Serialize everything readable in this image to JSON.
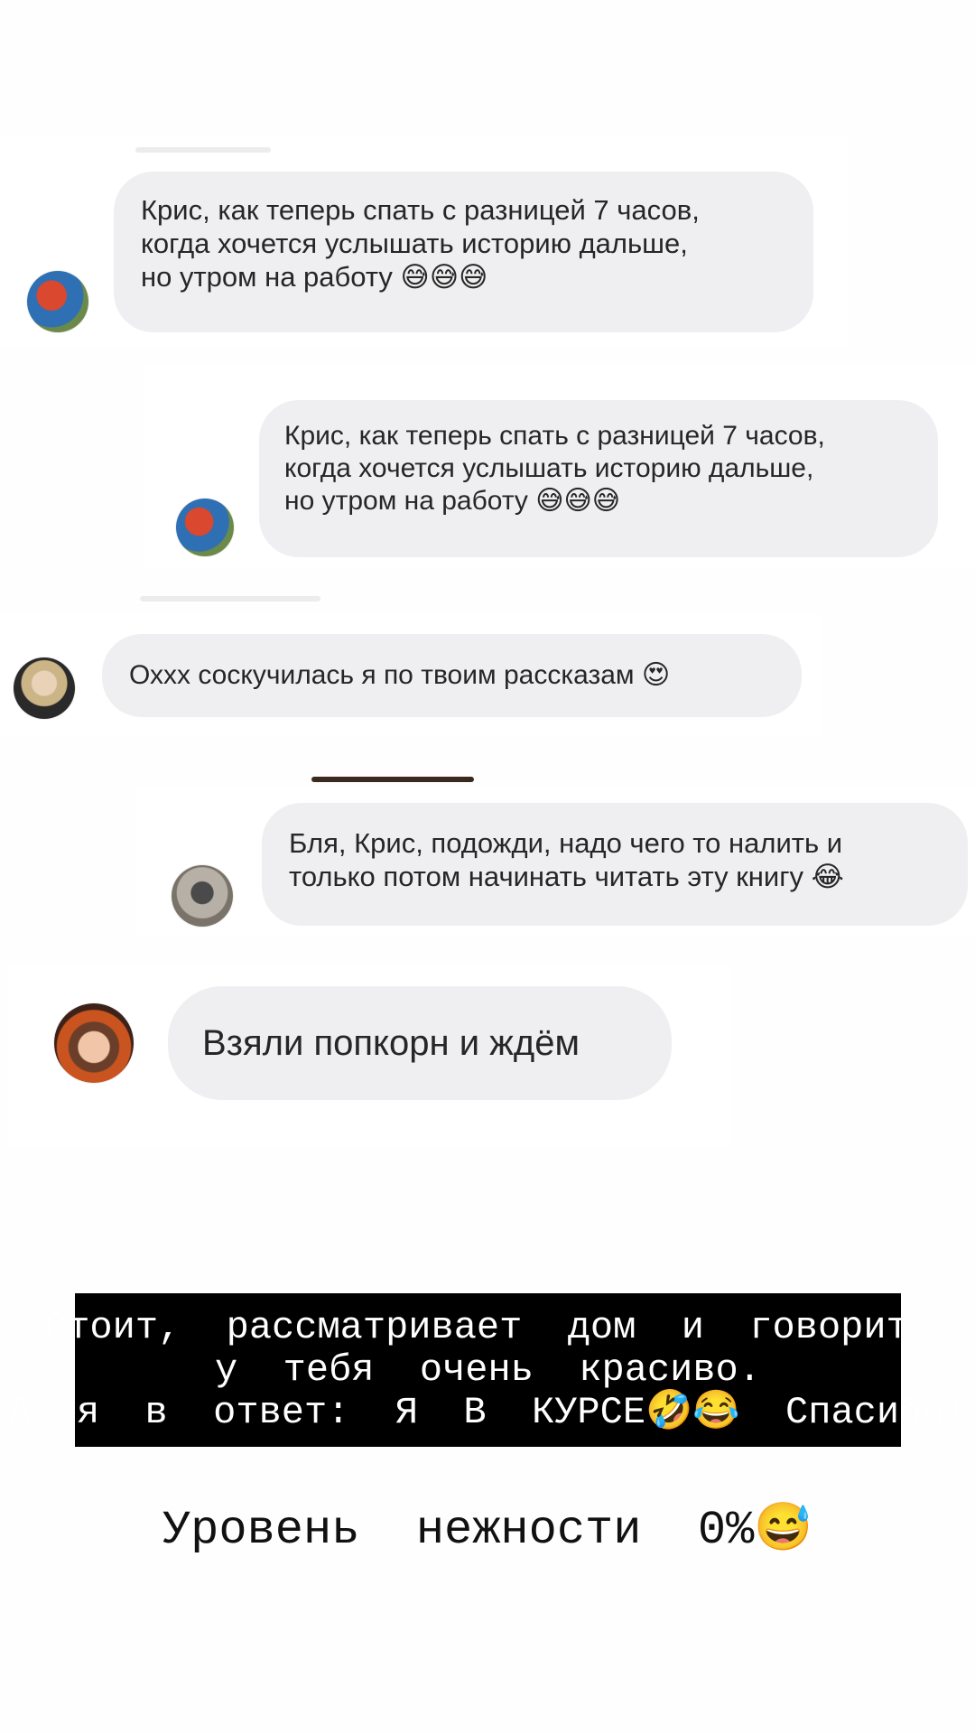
{
  "messages": [
    {
      "text": "Крис, как теперь спать с разницей 7 часов,",
      "text2": "когда хочется услышать историю дальше,",
      "text3": "но утром на работу",
      "emoji": "😅😅😅"
    },
    {
      "text": "Крис, как теперь спать с разницей 7 часов,",
      "text2": "когда хочется услышать историю дальше,",
      "text3": "но утром на работу",
      "emoji": "😅😅😅"
    },
    {
      "text": "Оххх соскучилась я по твоим рассказам",
      "emoji": "😍"
    },
    {
      "text": "Бля, Крис, подожди, надо чего то налить и",
      "text2": "только потом начинать читать эту книгу",
      "emoji": "😂"
    },
    {
      "text": "Взяли попкорн и ждём"
    }
  ],
  "caption": {
    "line1": "Стоит,  рассматривает  дом  и  говорит:",
    "line2": "у  тебя  очень  красиво.",
    "line3": "А  я  в  ответ:  Я  В  КУРСЕ🤣😂  Спасибо!"
  },
  "footer": {
    "text": "Уровень  нежности  0%😅"
  },
  "colors": {
    "bubble": "#efeff1",
    "caption_bg": "#000000",
    "caption_text": "#ffffff"
  },
  "icons": [
    "avatar-photo"
  ]
}
